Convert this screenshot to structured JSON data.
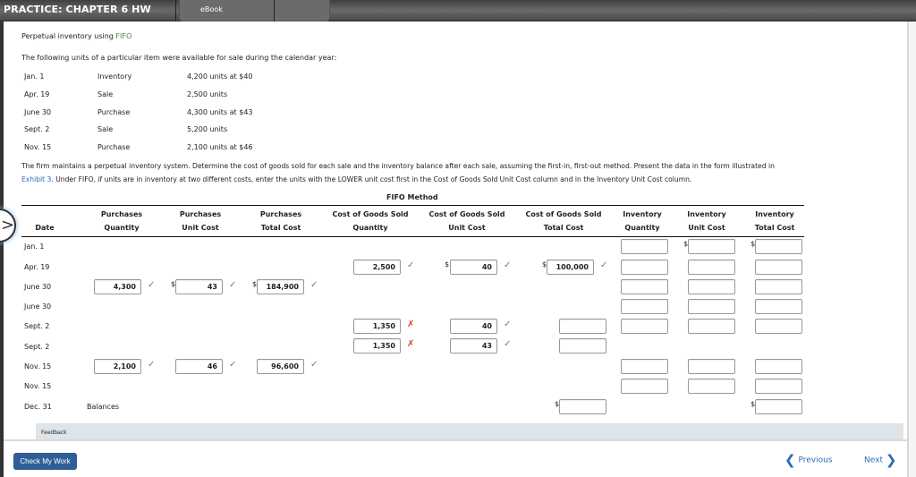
{
  "header": {
    "title": "PRACTICE: CHAPTER 6 HW",
    "tabs": [
      "eBook"
    ]
  },
  "problem": {
    "title_prefix": "Perpetual inventory using ",
    "title_highlight": "FIFO",
    "intro": "The following units of a particular item were available for sale during the calendar year:",
    "transactions": [
      {
        "date": "Jan. 1",
        "type": "Inventory",
        "detail": "4,200 units at $40"
      },
      {
        "date": "Apr. 19",
        "type": "Sale",
        "detail": "2,500 units"
      },
      {
        "date": "June 30",
        "type": "Purchase",
        "detail": "4,300 units at $43"
      },
      {
        "date": "Sept. 2",
        "type": "Sale",
        "detail": "5,200 units"
      },
      {
        "date": "Nov. 15",
        "type": "Purchase",
        "detail": "2,100 units at $46"
      }
    ],
    "instructions_line1": "The firm maintains a perpetual inventory system. Determine the cost of goods sold for each sale and the inventory balance after each sale, assuming the first-in, first-out method. Present the data in the form illustrated in",
    "instructions_link": "Exhibit 3",
    "instructions_line2": ". Under FIFO, if units are in inventory at two different costs, enter the units with the LOWER unit cost first in the Cost of Goods Sold Unit Cost column and in the Inventory Unit Cost column."
  },
  "table": {
    "title": "FIFO Method",
    "headers": [
      {
        "l1": "",
        "l2": "Date"
      },
      {
        "l1": "Purchases",
        "l2": "Quantity"
      },
      {
        "l1": "Purchases",
        "l2": "Unit Cost"
      },
      {
        "l1": "Purchases",
        "l2": "Total Cost"
      },
      {
        "l1": "Cost of Goods Sold",
        "l2": "Quantity"
      },
      {
        "l1": "Cost of Goods Sold",
        "l2": "Unit Cost"
      },
      {
        "l1": "Cost of Goods Sold",
        "l2": "Total Cost"
      },
      {
        "l1": "Inventory",
        "l2": "Quantity"
      },
      {
        "l1": "Inventory",
        "l2": "Unit Cost"
      },
      {
        "l1": "Inventory",
        "l2": "Total Cost"
      }
    ],
    "rows": [
      {
        "date": "Jan. 1"
      },
      {
        "date": "Apr. 19"
      },
      {
        "date": "June 30"
      },
      {
        "date": "June 30"
      },
      {
        "date": "Sept. 2"
      },
      {
        "date": "Sept. 2"
      },
      {
        "date": "Nov. 15"
      },
      {
        "date": "Nov. 15"
      },
      {
        "date": "Dec. 31",
        "label": "Balances"
      }
    ],
    "values": {
      "june30_purch_qty": "4,300",
      "june30_purch_unit": "43",
      "june30_purch_total": "184,900",
      "apr19_cogs_qty": "2,500",
      "apr19_cogs_unit": "40",
      "apr19_cogs_total": "100,000",
      "sept2a_cogs_qty": "1,350",
      "sept2a_cogs_unit": "40",
      "sept2b_cogs_qty": "1,350",
      "sept2b_cogs_unit": "43",
      "nov15_purch_qty": "2,100",
      "nov15_purch_unit": "46",
      "nov15_purch_total": "96,600"
    },
    "currency": "$",
    "correct_mark": "✓",
    "incorrect_mark": "✗"
  },
  "feedback_label": "Feedback",
  "footer": {
    "check_button": "Check My Work",
    "previous": "Previous",
    "next": "Next"
  }
}
